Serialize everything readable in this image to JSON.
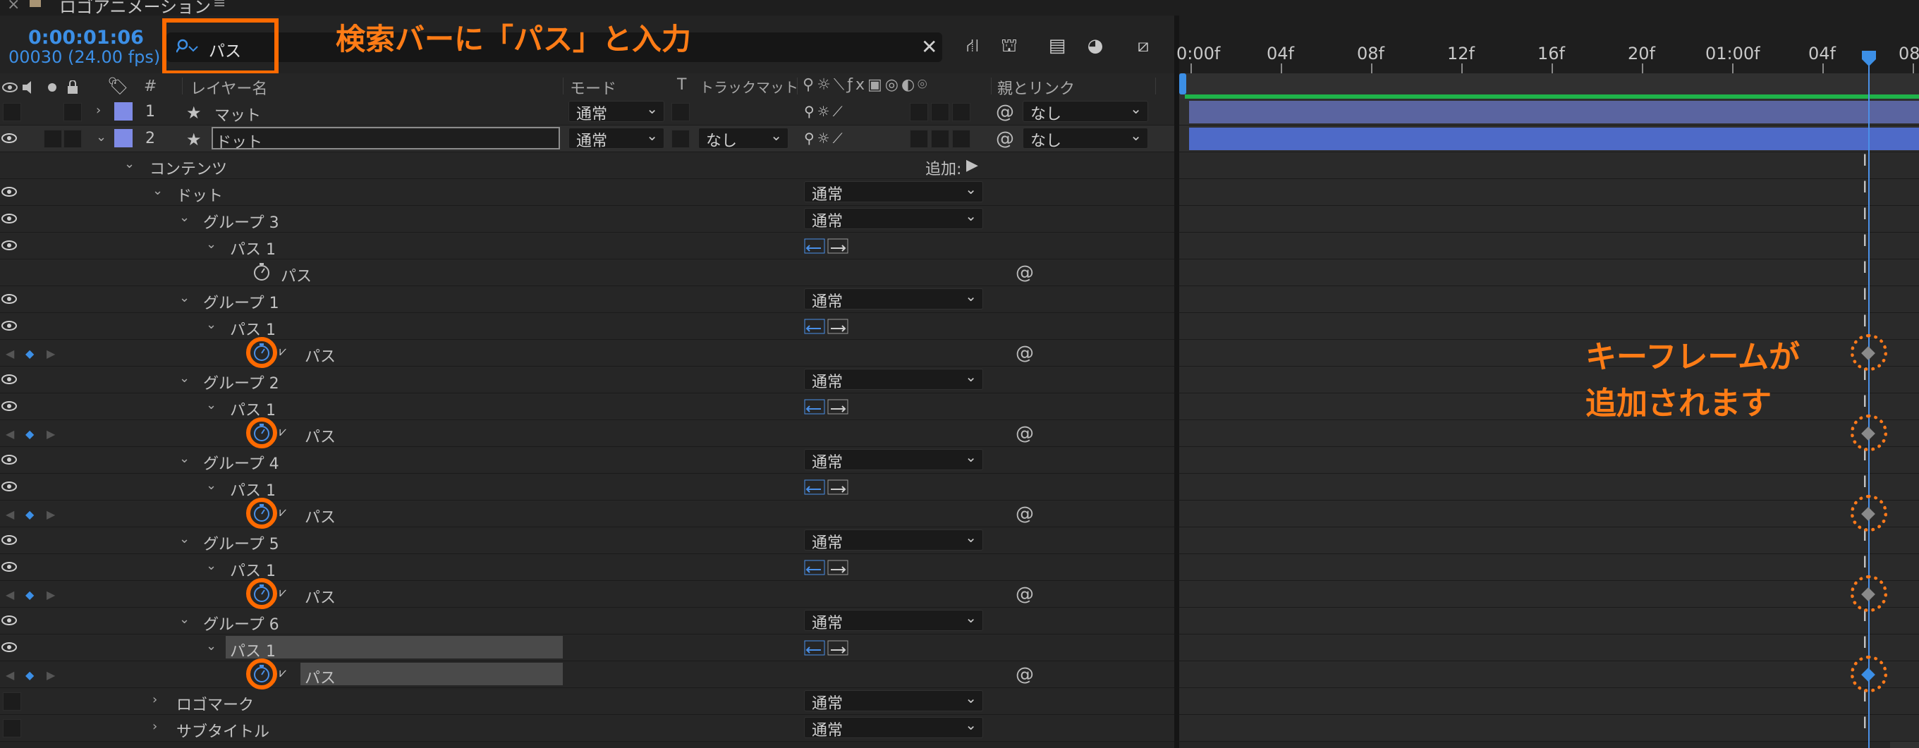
{
  "window": {
    "tab_title": "ロゴアニメーション",
    "menu_glyph": "≡",
    "close_glyph": "×"
  },
  "time": {
    "timecode": "0:00:01:06",
    "frames": "00030 (24.00 fps)"
  },
  "search": {
    "value": "パス",
    "annotation": "検索バーに「パス」と入力"
  },
  "columns": {
    "layer_name": "レイヤー名",
    "mode": "モード",
    "t": "T",
    "trackmatte": "トラックマット",
    "parent": "親とリンク",
    "num": "#"
  },
  "ruler": [
    "0:00f",
    "04f",
    "08f",
    "12f",
    "16f",
    "20f",
    "01:00f",
    "04f",
    "08"
  ],
  "layers": [
    {
      "num": "1",
      "name": "マット",
      "mode": "通常",
      "trackmatte": "",
      "parent": "なし"
    },
    {
      "num": "2",
      "name": "ドット",
      "mode": "通常",
      "trackmatte": "なし",
      "parent": "なし"
    }
  ],
  "tree": {
    "contents": "コンテンツ",
    "add_label": "追加:",
    "dot": "ドット",
    "mode_normal": "通常",
    "groups": [
      "グループ 3",
      "グループ 1",
      "グループ 2",
      "グループ 4",
      "グループ 5",
      "グループ 6"
    ],
    "path1": "パス 1",
    "path": "パス",
    "logomark": "ロゴマーク",
    "subtitle": "サブタイトル"
  },
  "annotation": {
    "keyframe_line1": "キーフレームが",
    "keyframe_line2": "追加されます"
  },
  "colors": {
    "accent_blue": "#3c8fe6",
    "annotation_orange": "#ff6a00",
    "layer_label": "#7f8be6",
    "green_bar": "#1fb34a"
  }
}
